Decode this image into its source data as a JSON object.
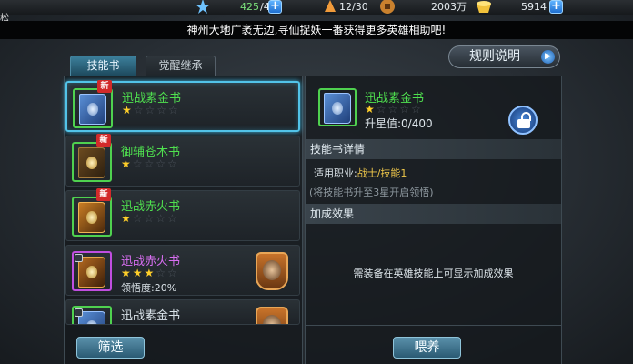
{
  "player": {
    "name": "松"
  },
  "resources": {
    "stamina": {
      "icon": "stamina-icon",
      "value": "425",
      "max": "/40"
    },
    "energy": {
      "icon": "energy-icon",
      "value": "12/30"
    },
    "coins": {
      "icon": "coin-icon",
      "value": "2003万"
    },
    "gold": {
      "icon": "gold-ingot-icon",
      "value": "5914"
    },
    "plus_label": "+"
  },
  "marquee": {
    "text": "神州大地广袤无边,寻仙捉妖一番获得更多英雄相助吧!"
  },
  "tabs": [
    {
      "label": "技能书",
      "active": true
    },
    {
      "label": "觉醒继承",
      "active": false
    }
  ],
  "rules_button": {
    "label": "规则说明",
    "arrow": "▶"
  },
  "skill_books": [
    {
      "name": "迅战素金书",
      "stars": "★☆☆☆☆",
      "stars_on": "★",
      "stars_off": "☆☆☆☆",
      "badge": "新",
      "rarity": "green",
      "selected": true
    },
    {
      "name": "御辅苍木书",
      "stars_on": "★",
      "stars_off": "☆☆☆☆",
      "badge": "新",
      "rarity": "green",
      "selected": false
    },
    {
      "name": "迅战赤火书",
      "stars_on": "★",
      "stars_off": "☆☆☆☆",
      "badge": "新",
      "rarity": "green",
      "selected": false
    },
    {
      "name": "迅战赤火书",
      "stars_on": "★★★",
      "stars_off": "☆☆",
      "extra": "领悟度:20%",
      "rarity": "purple",
      "equipped_hero": true,
      "selected": false
    },
    {
      "name": "迅战素金书",
      "rarity": "green",
      "equipped_hero": true,
      "selected": false
    }
  ],
  "detail": {
    "name": "迅战素金书",
    "stars_on": "★",
    "stars_off": "☆☆☆☆",
    "upgrade": "升星值:0/400",
    "lock_icon": "unlock-icon",
    "section_title": "技能书详情",
    "job_label": "适用职业:",
    "job_value": "战士/技能1",
    "note": "(将技能书升至3星开启领悟)",
    "bonus_title": "加成效果",
    "bonus_message": "需装备在英雄技能上可显示加成效果"
  },
  "buttons": {
    "filter": "筛选",
    "feed": "喂养"
  },
  "colors": {
    "green_rarity": "#4fe04f",
    "purple_rarity": "#d76ef0",
    "star": "#ffcf2a",
    "accent": "#52c3e8"
  }
}
